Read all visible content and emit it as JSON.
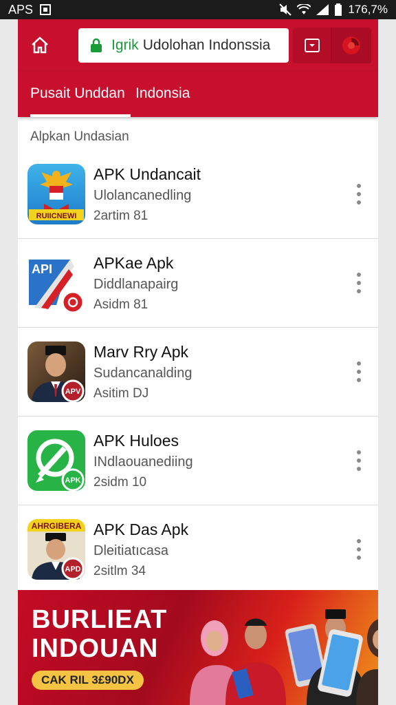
{
  "status_bar": {
    "left_text": "APS",
    "right_text": "176,7%"
  },
  "browser": {
    "url_prefix": "Igrik",
    "url_text": "Udolohan Indonssia"
  },
  "tabs": [
    {
      "label": "Pusait Unddan"
    },
    {
      "label": "Indonsia"
    }
  ],
  "section_title": "Alpkan Undasian",
  "apps": [
    {
      "name": "APK Undancait",
      "subtitle": "Ulolancanedling",
      "meta": "2artim 81",
      "badge": "RUIICNEWI"
    },
    {
      "name": "APKae Apk",
      "subtitle": "Diddlanapairg",
      "meta": "Asidm 81",
      "badge": "API"
    },
    {
      "name": "Marv Rry Apk",
      "subtitle": "Sudancanalding",
      "meta": "Asitim DJ",
      "badge": "APV"
    },
    {
      "name": "APK Huloes",
      "subtitle": "INdlaouanediing",
      "meta": "2sidm 10",
      "badge": "APK"
    },
    {
      "name": "APK Das Apk",
      "subtitle": "Dleitiatıcasa",
      "meta": "2sitlm 34",
      "badge": "APD",
      "top_label": "AHRGIBERA"
    }
  ],
  "banner": {
    "line1": "BURLIEAT",
    "line2": "INDOUAN",
    "promo": "CAK RIL 3£90DX"
  },
  "colors": {
    "primary_red": "#c8102e",
    "accent_yellow": "#f5c342"
  }
}
